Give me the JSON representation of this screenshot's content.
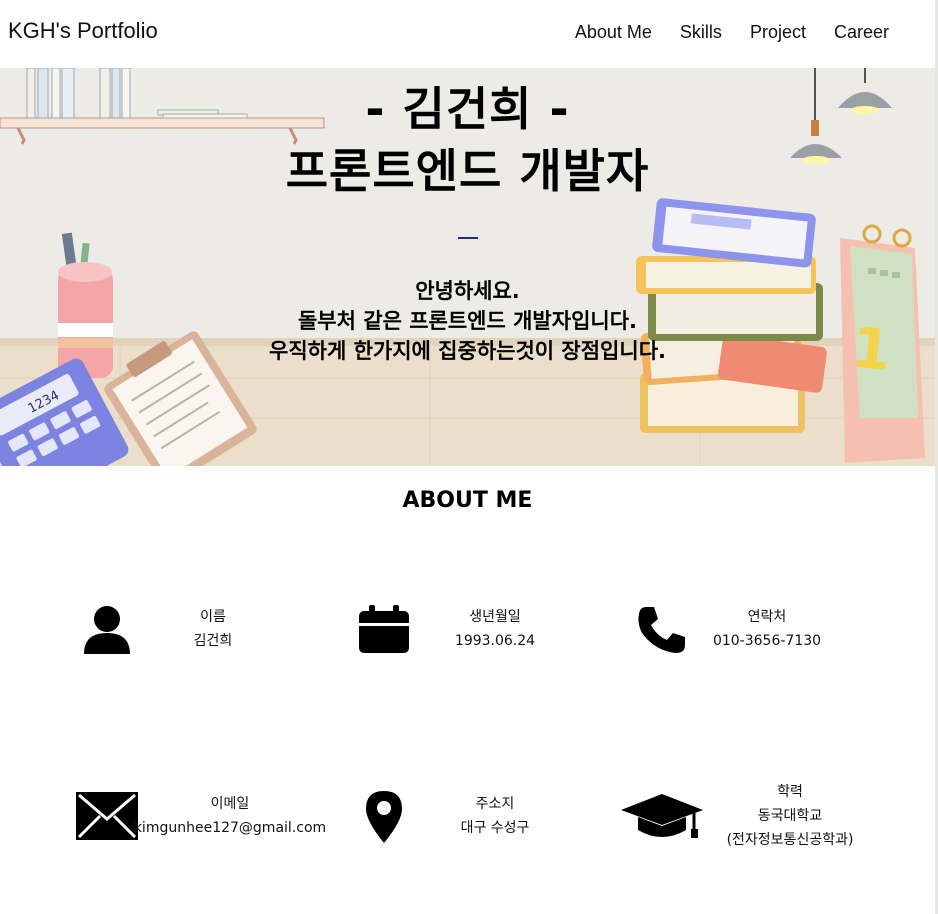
{
  "nav": {
    "brand": "KGH's Portfolio",
    "links": [
      "About Me",
      "Skills",
      "Project",
      "Career"
    ]
  },
  "hero": {
    "name_line": "- 김건희 -",
    "role_line": "프론트엔드 개발자",
    "intro": [
      "안녕하세요.",
      "돌부처 같은 프론트엔드 개발자입니다.",
      "우직하게 한가지에 집중하는것이 장점입니다."
    ],
    "calculator_display": "1234",
    "calendar_number": "1"
  },
  "about": {
    "heading": "ABOUT ME",
    "items": [
      {
        "icon": "user-icon",
        "label": "이름",
        "value": "김건희"
      },
      {
        "icon": "calendar-icon",
        "label": "생년월일",
        "value": "1993.06.24"
      },
      {
        "icon": "phone-icon",
        "label": "연락처",
        "value": "010-3656-7130"
      },
      {
        "icon": "envelope-icon",
        "label": "이메일",
        "value": "kimgunhee127@gmail.com"
      },
      {
        "icon": "map-pin-icon",
        "label": "주소지",
        "value": "대구 수성구"
      },
      {
        "icon": "graduation-cap-icon",
        "label": "학력",
        "value": "동국대학교",
        "value2": "(전자정보통신공학과)"
      }
    ]
  },
  "colors": {
    "hero_wall": "#ecebe6",
    "desk": "#e3d1b6",
    "divider": "#1f2e7a"
  }
}
